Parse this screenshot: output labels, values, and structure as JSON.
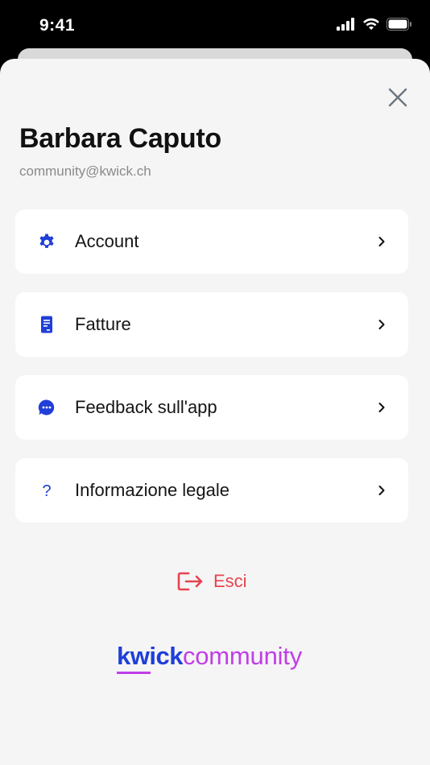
{
  "status_bar": {
    "time": "9:41"
  },
  "profile": {
    "name": "Barbara Caputo",
    "email": "community@kwick.ch"
  },
  "menu": {
    "items": [
      {
        "label": "Account",
        "icon": "gear-icon"
      },
      {
        "label": "Fatture",
        "icon": "invoice-icon"
      },
      {
        "label": "Feedback sull'app",
        "icon": "chat-bubble-icon"
      },
      {
        "label": "Informazione legale",
        "icon": "question-mark-icon"
      }
    ]
  },
  "logout": {
    "label": "Esci",
    "icon": "logout-icon"
  },
  "brand": {
    "part1": "kwick",
    "part2": "community"
  },
  "colors": {
    "accent_blue": "#1f3fd8",
    "brand_magenta": "#c13ee8",
    "logout_red": "#e8434f",
    "sheet_bg": "#f5f5f5"
  }
}
